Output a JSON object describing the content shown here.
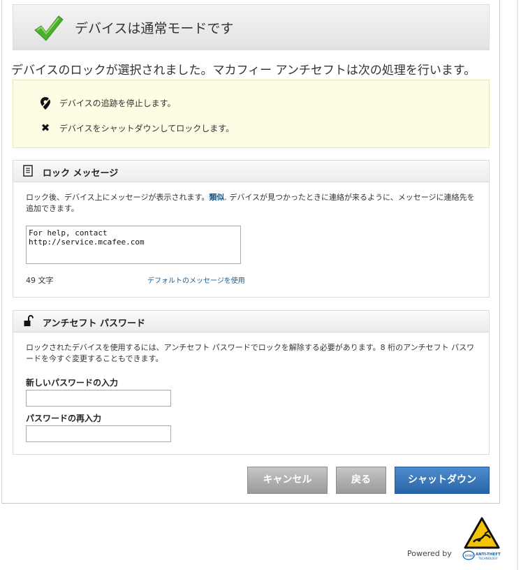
{
  "header": {
    "title": "デバイスは通常モードです"
  },
  "intro": "デバイスのロックが選択されました。マカフィー アンチセフトは次の処理を行います。",
  "actions": [
    {
      "icon": "location-pin-icon",
      "text": "デバイスの追跡を停止します。"
    },
    {
      "icon": "x-mark-icon",
      "text": "デバイスをシャットダウンしてロックします。"
    }
  ],
  "lock_message": {
    "title": "ロック メッセージ",
    "desc_before": "ロック後、デバイス上にメッセージが表示されます。",
    "desc_link": "類似",
    "desc_after": ". デバイスが見つかったときに連絡が来るように、メッセージに連絡先を追加できます。",
    "message_value": "For help, contact\nhttp://service.mcafee.com",
    "char_count": "49 文字",
    "default_link": "デフォルトのメッセージを使用"
  },
  "password": {
    "title": "アンチセフト パスワード",
    "desc": "ロックされたデバイスを使用するには、アンチセフト パスワードでロックを解除する必要があります。8 桁のアンチセフト パスワードを今すぐ変更することもできます。",
    "new_label": "新しいパスワードの入力",
    "reenter_label": "パスワードの再入力"
  },
  "buttons": {
    "cancel": "キャンセル",
    "back": "戻る",
    "shutdown": "シャットダウン"
  },
  "footer": {
    "powered_by": "Powered by",
    "brand_text": "ANTI-THEFT TECHNOLOGY"
  },
  "colors": {
    "accent_blue": "#2f6fb4",
    "check_green": "#4caf2a",
    "notice_bg": "#fdfde3",
    "link_blue": "#1a5a8c"
  }
}
